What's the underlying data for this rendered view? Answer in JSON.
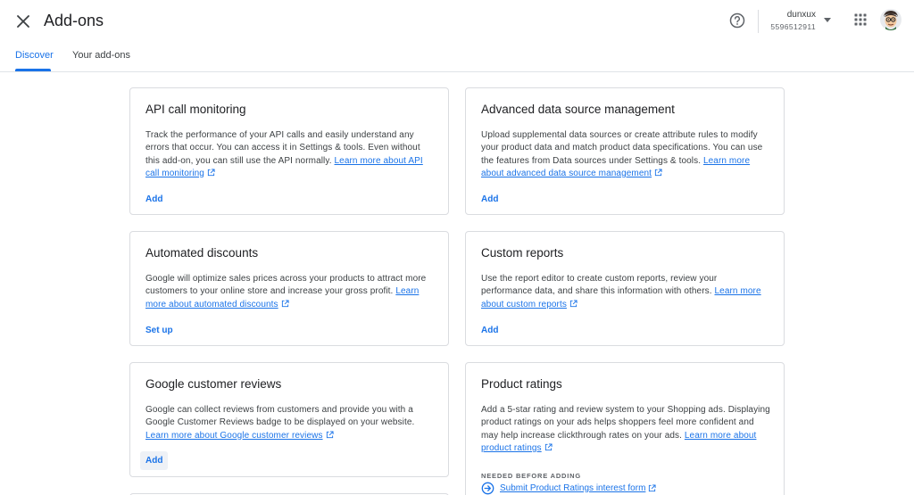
{
  "header": {
    "title": "Add-ons",
    "account_name": "dunxux",
    "account_id": "5596512911"
  },
  "icons": {
    "close": "close-icon",
    "help": "help-circle-icon",
    "apps": "apps-grid-icon",
    "avatar": "avatar-icon",
    "external": "external-link-icon"
  },
  "tabs": [
    {
      "label": "Discover",
      "active": true
    },
    {
      "label": "Your add-ons",
      "active": false
    }
  ],
  "colors": {
    "accent": "#1a73e8",
    "text": "#202124",
    "border": "#dadce0"
  },
  "cards": [
    {
      "title": "API call monitoring",
      "desc_lines": [
        "Track the performance of your API calls and easily understand any",
        "errors that occur. You can access it in Settings & tools. Even without",
        "this add-on, you can still use the API normally. "
      ],
      "link_parts": [
        "Learn more about API",
        "call monitoring"
      ],
      "action": "Add"
    },
    {
      "title": "Advanced data source management",
      "desc_lines": [
        "Upload supplemental data sources or create attribute rules to modify",
        "your product data and match product data specifications. You can use",
        "the features from Data sources under Settings & tools. "
      ],
      "link_parts": [
        "Learn more",
        "about advanced data source management"
      ],
      "action": "Add"
    },
    {
      "title": "Automated discounts",
      "desc_lines": [
        "Google will optimize sales prices across your products to attract more",
        "customers to your online store and increase your gross profit. "
      ],
      "link_parts": [
        "Learn",
        "more about automated discounts"
      ],
      "action": "Set up"
    },
    {
      "title": "Custom reports",
      "desc_lines": [
        "Use the report editor to create custom reports, review your",
        "performance data, and share this information with others. "
      ],
      "link_parts": [
        "Learn more",
        "about custom reports"
      ],
      "action": "Add"
    },
    {
      "title": "Google customer reviews",
      "desc_lines": [
        "Google can collect reviews from customers and provide you with a",
        "Google Customer Reviews badge to be displayed on your website."
      ],
      "link_parts": [
        "Learn more about Google customer reviews"
      ],
      "action": "Add"
    },
    {
      "title": "Product ratings",
      "desc_lines": [
        "Add a 5-star rating and review system to your Shopping ads. Displaying",
        "product ratings on your ads helps shoppers feel more confident and",
        "may help increase clickthrough rates on your ads. "
      ],
      "link_parts": [
        "Learn more about",
        "product ratings"
      ],
      "needed_label": "NEEDED BEFORE ADDING",
      "needed_link": "Submit Product Ratings interest form"
    }
  ]
}
